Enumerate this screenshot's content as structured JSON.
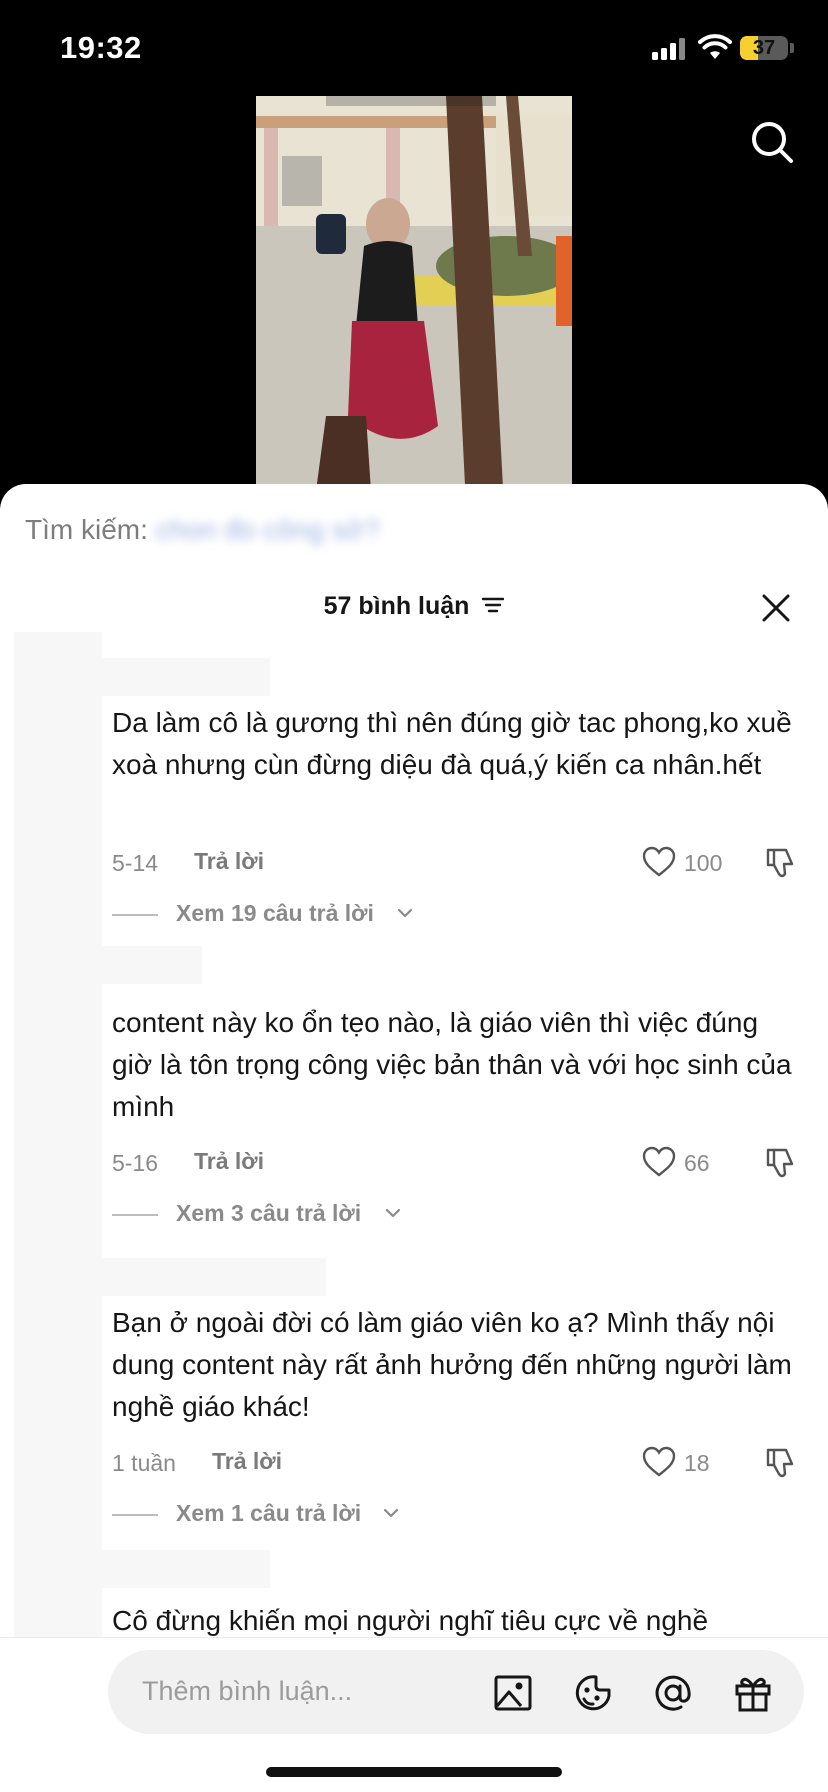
{
  "status_bar": {
    "time": "19:32",
    "battery": "37",
    "battery_level": 0.37
  },
  "search_suggest": {
    "label": "Tìm kiếm:",
    "query": "chon đo công sở?"
  },
  "header": {
    "title": "57 bình luận"
  },
  "comments": [
    {
      "text": "Da làm cô là gương thì nên đúng giờ tac phong,ko xuề xoà nhưng cùn đừng diệu đà quá,ý kiến ca nhân.hết",
      "date": "5-14",
      "reply_label": "Trả lời",
      "likes": "100",
      "view_replies": "Xem 19 câu trả lời"
    },
    {
      "text": "content này ko ổn tẹo nào, là giáo viên thì việc đúng giờ là tôn trọng công việc bản thân và với học sinh của mình",
      "date": "5-16",
      "reply_label": "Trả lời",
      "likes": "66",
      "view_replies": "Xem 3 câu trả lời"
    },
    {
      "text": "Bạn ở ngoài đời có làm giáo viên ko ạ? Mình thấy nội dung content này rất ảnh hưởng đến những người làm nghề giáo khác!",
      "date": "1 tuần",
      "reply_label": "Trả lời",
      "likes": "18",
      "view_replies": "Xem 1 câu trả lời"
    },
    {
      "text": "Cô đừng khiến mọi người nghĩ tiêu cực về nghề"
    }
  ],
  "input": {
    "placeholder": "Thêm bình luận..."
  },
  "icons": {
    "search": "search-icon",
    "sort": "sort-icon",
    "close": "close-icon",
    "like": "heart-icon",
    "dislike": "thumbs-down-icon",
    "chevron": "chevron-down-icon",
    "image": "image-icon",
    "emoji": "emoji-icon",
    "mention": "at-icon",
    "gift": "gift-icon"
  },
  "colors": {
    "accent": "#f6d02f",
    "text": "#161616",
    "muted": "#8a8a8a",
    "sheet": "#ffffff"
  }
}
